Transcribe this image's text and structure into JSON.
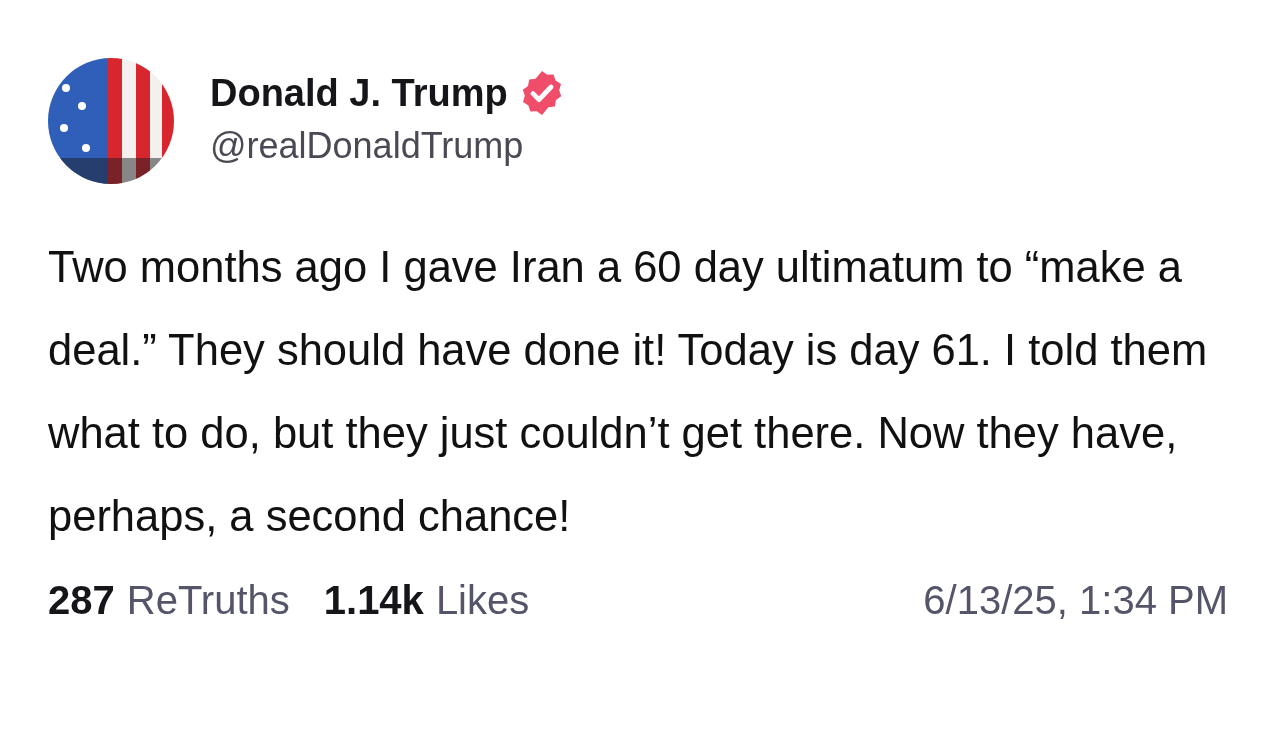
{
  "post": {
    "author": {
      "name": "Donald J. Trump",
      "verified": true,
      "handle": "@realDonaldTrump"
    },
    "body": "Two months ago I gave Iran a 60 day ultimatum to “make a deal.” They should have done it! Today is day 61. I told them what to do, but they just couldn’t get there. Now they have, perhaps, a second chance!",
    "stats": [
      {
        "count": "287",
        "label": "ReTruths"
      },
      {
        "count": "1.14k",
        "label": "Likes"
      }
    ],
    "timestamp": "6/13/25, 1:34 PM"
  }
}
